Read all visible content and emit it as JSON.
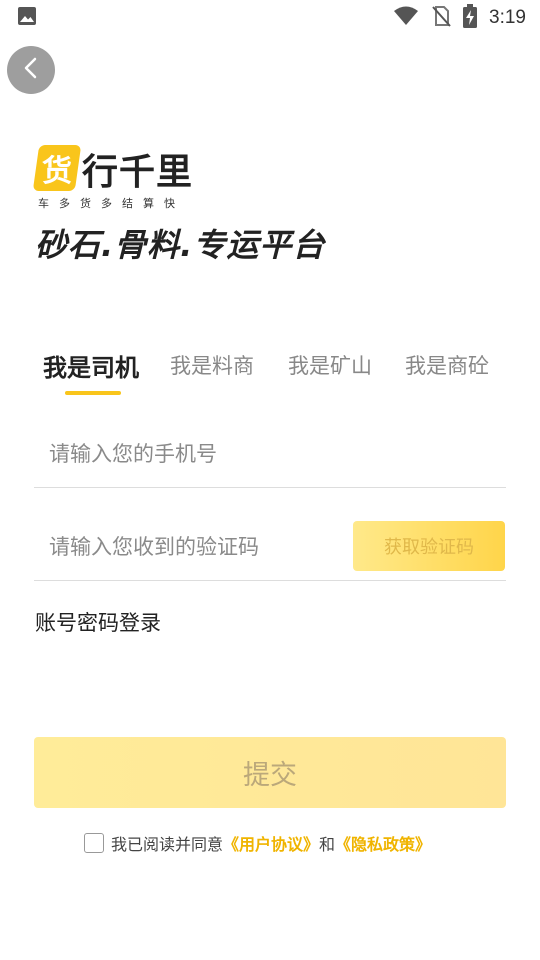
{
  "status_bar": {
    "time": "3:19"
  },
  "logo": {
    "badge_char": "货",
    "name": "行千里",
    "tagline": "车多货多结算快"
  },
  "slogan": "砂石.骨料.专运平台",
  "tabs": [
    {
      "label": "我是司机",
      "active": true
    },
    {
      "label": "我是料商",
      "active": false
    },
    {
      "label": "我是矿山",
      "active": false
    },
    {
      "label": "我是商砼",
      "active": false
    }
  ],
  "form": {
    "phone_placeholder": "请输入您的手机号",
    "phone_value": "",
    "code_placeholder": "请输入您收到的验证码",
    "code_value": "",
    "get_code_label": "获取验证码",
    "password_login_label": "账号密码登录",
    "submit_label": "提交"
  },
  "agreement": {
    "checked": false,
    "prefix": "我已阅读并同意",
    "user_agreement": "《用户协议》",
    "conjunction": "和",
    "privacy_policy": "《隐私政策》"
  },
  "colors": {
    "accent": "#f9c51b",
    "link": "#f0b400",
    "submit_bg": "#ffec99"
  }
}
